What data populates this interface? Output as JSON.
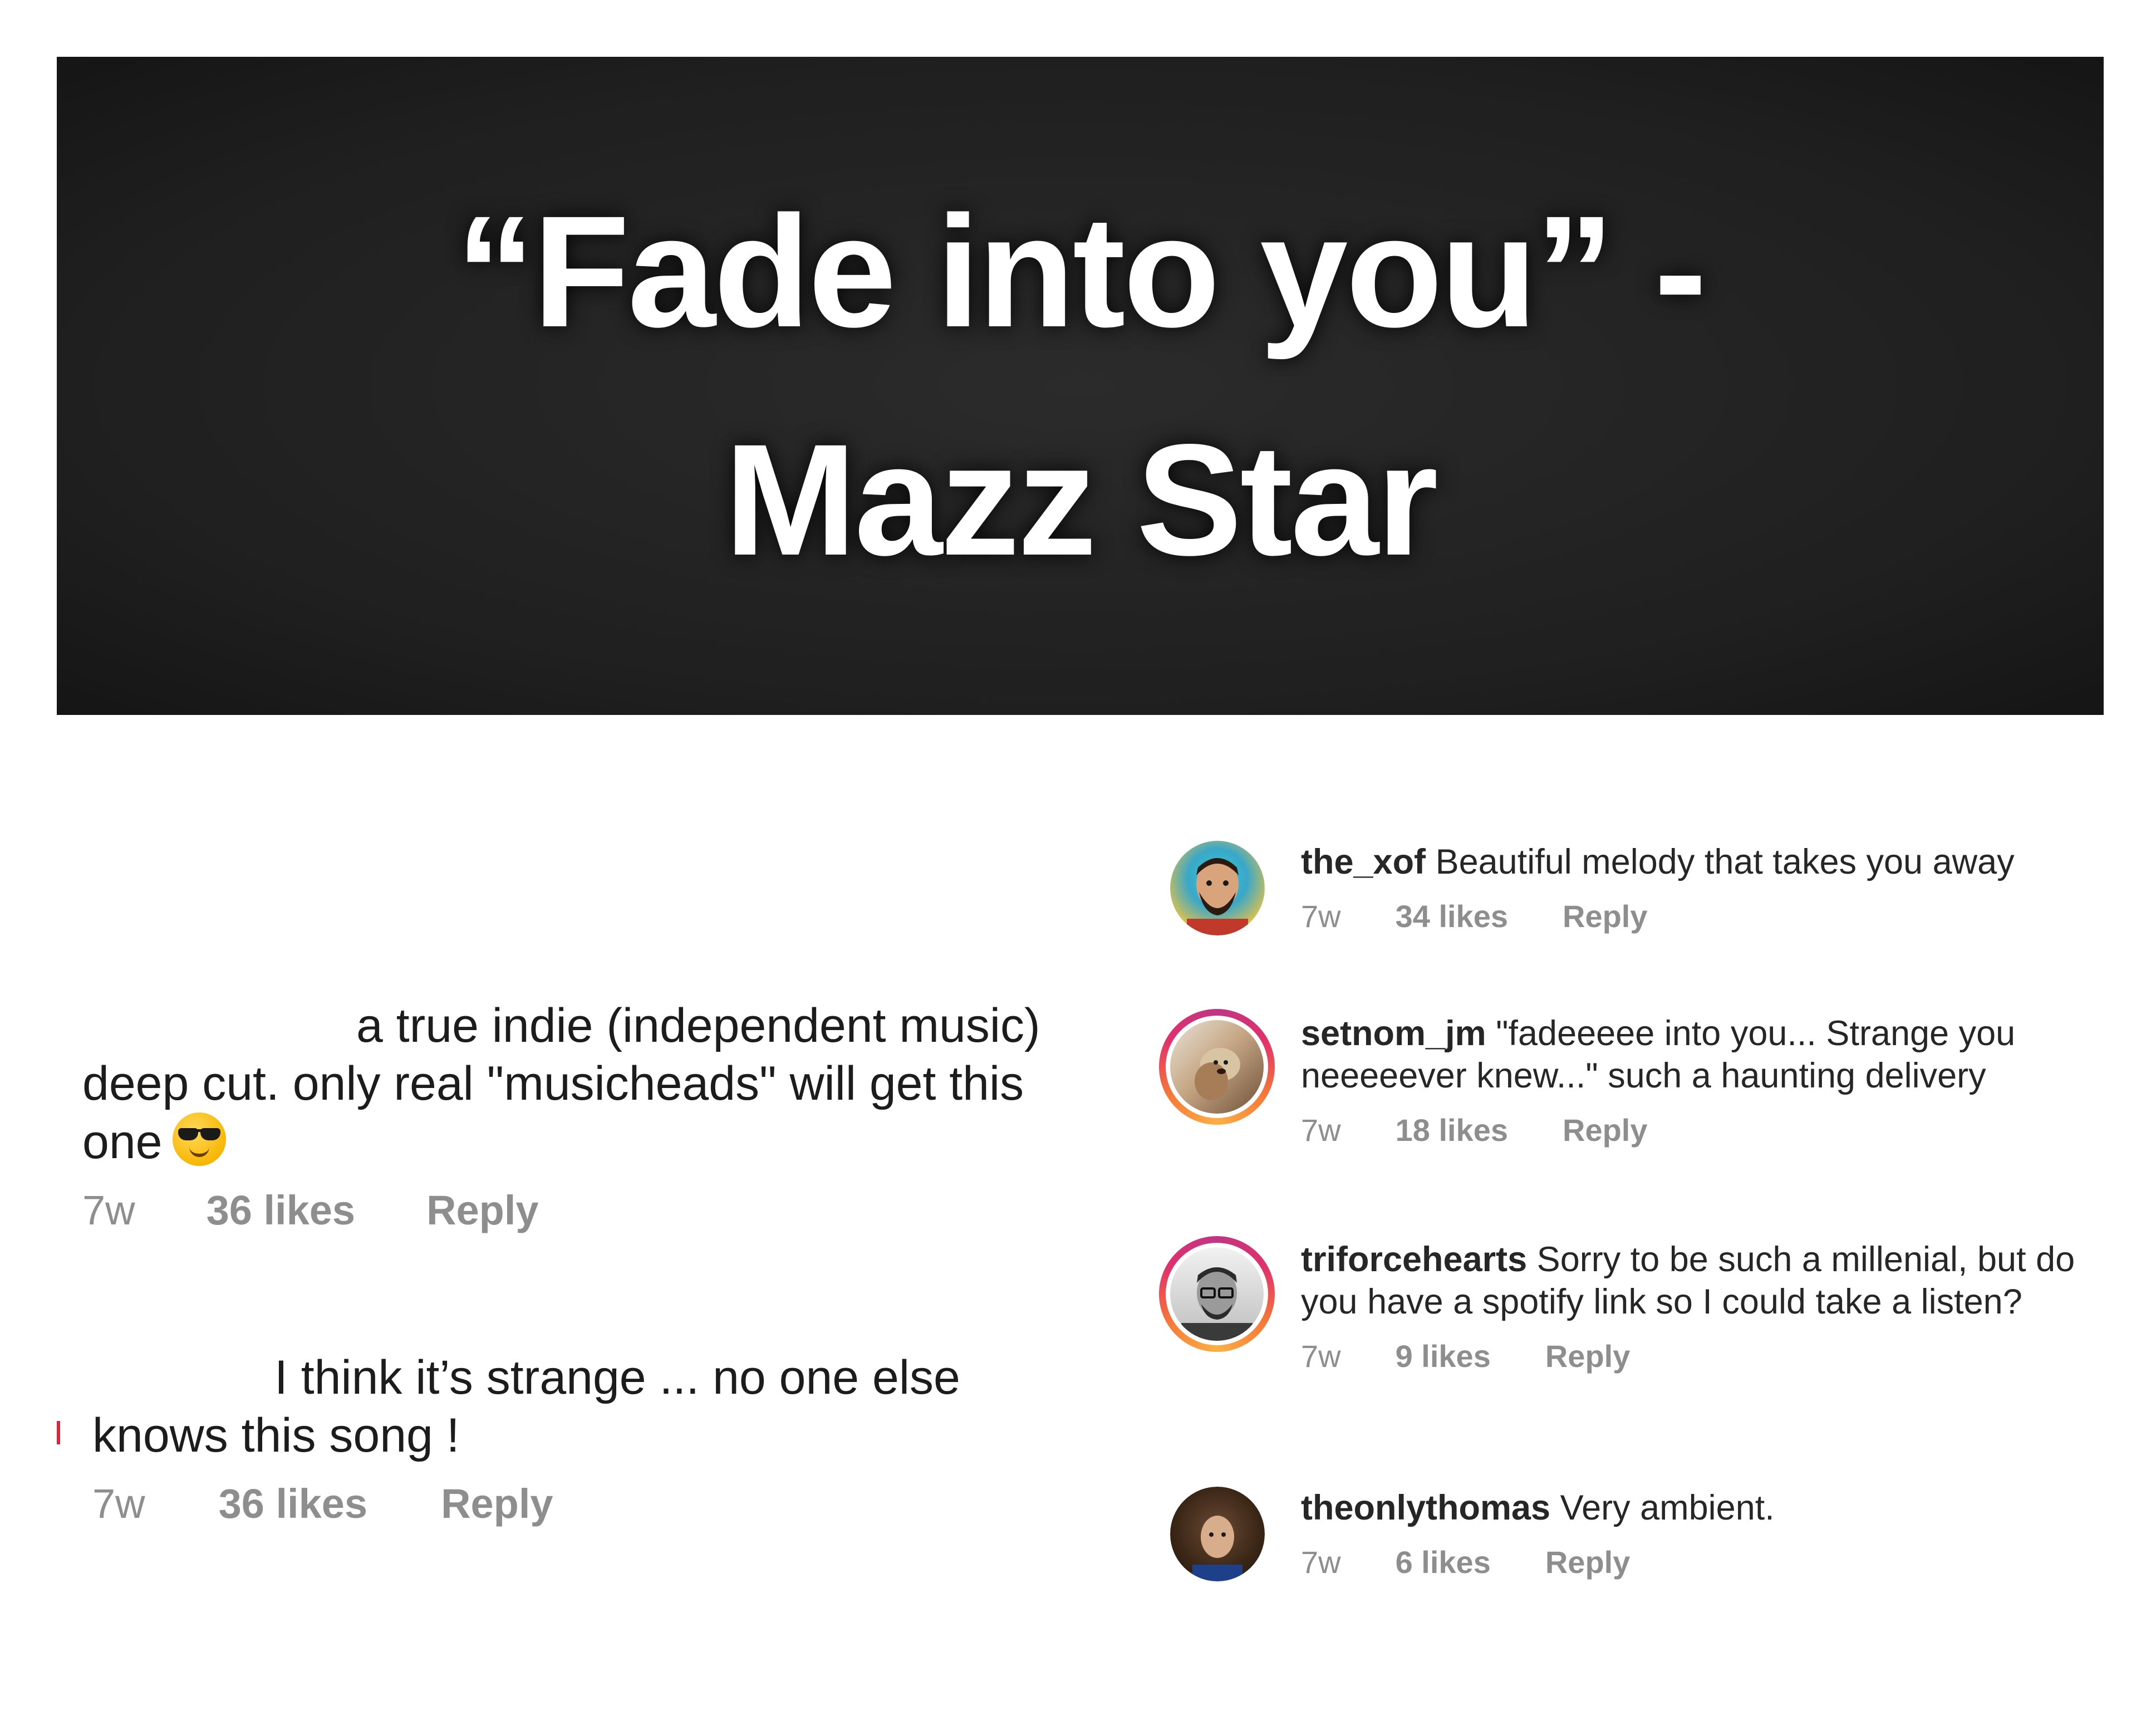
{
  "banner": {
    "line1": "“Fade into you” -",
    "line2": "Mazz Star"
  },
  "left_comments": [
    {
      "text_line1": "a true indie (independent music)",
      "text_line2": "deep cut. only real \"musicheads\" will get this",
      "text_line3": "one",
      "emoji": "sunglasses-emoji",
      "time": "7w",
      "likes": "36 likes",
      "reply": "Reply"
    },
    {
      "text_line1": "I think it’s strange ... no one else",
      "text_line2": "knows this song !",
      "time": "7w",
      "likes": "36 likes",
      "reply": "Reply"
    }
  ],
  "right_comments": [
    {
      "username": "the_xof",
      "text": "Beautiful melody that takes you away",
      "time": "7w",
      "likes": "34 likes",
      "reply": "Reply",
      "avatar": "man-beard-avatar",
      "story_ring": false
    },
    {
      "username": "setnom_jm",
      "text": "\"fadeeeee into you... Strange you neeeeever knew...\" such a haunting delivery",
      "time": "7w",
      "likes": "18 likes",
      "reply": "Reply",
      "avatar": "dog-photo-avatar",
      "story_ring": true
    },
    {
      "username": "triforcehearts",
      "text": "Sorry to be such a millenial, but do you have a spotify link so I could take a listen?",
      "time": "7w",
      "likes": "9 likes",
      "reply": "Reply",
      "avatar": "man-glasses-avatar",
      "story_ring": true
    },
    {
      "username": "theonlythomas",
      "text": "Very ambient.",
      "time": "7w",
      "likes": "6 likes",
      "reply": "Reply",
      "avatar": "curly-hair-avatar",
      "story_ring": false
    }
  ],
  "colors": {
    "banner_bg": "#1f1f1f",
    "banner_text": "#ffffff",
    "meta_gray": "#8e8e8e",
    "story_ring_start": "#c13584",
    "story_ring_end": "#fcaf45"
  }
}
